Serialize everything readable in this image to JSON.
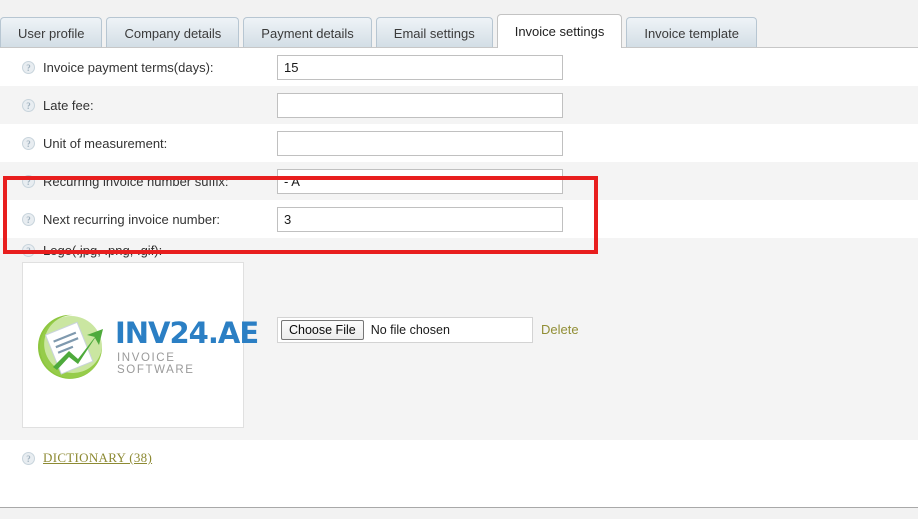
{
  "tabs": [
    {
      "label": "User profile",
      "active": false
    },
    {
      "label": "Company details",
      "active": false
    },
    {
      "label": "Payment details",
      "active": false
    },
    {
      "label": "Email settings",
      "active": false
    },
    {
      "label": "Invoice settings",
      "active": true
    },
    {
      "label": "Invoice template",
      "active": false
    }
  ],
  "help_icon_glyph": "?",
  "form": {
    "rows": [
      {
        "label": "Invoice payment terms(days):",
        "value": "15",
        "placeholder": ""
      },
      {
        "label": "Late fee:",
        "value": "",
        "placeholder": ""
      },
      {
        "label": "Unit of measurement:",
        "value": "",
        "placeholder": ""
      },
      {
        "label": "Recurring invoice number suffix:",
        "value": "- A",
        "placeholder": ""
      },
      {
        "label": "Next recurring invoice number:",
        "value": "3",
        "placeholder": ""
      }
    ]
  },
  "logo_section": {
    "label": "Logo(.jpg, .png, .gif):",
    "logo_alt_main": "INV24.AE",
    "logo_alt_sub": "INVOICE SOFTWARE",
    "choose_file_label": "Choose File",
    "no_file_text": "No file chosen",
    "delete_label": "Delete"
  },
  "footer": {
    "dictionary_label": "DICTIONARY (38)"
  },
  "colors": {
    "highlight_box": "#e81e1e",
    "link_olive": "#8d8a33",
    "logo_blue": "#2b7fc4",
    "logo_green": "#8dc63f",
    "row_alt_bg": "#f4f4f4",
    "tab_active_bg": "#ffffff"
  }
}
